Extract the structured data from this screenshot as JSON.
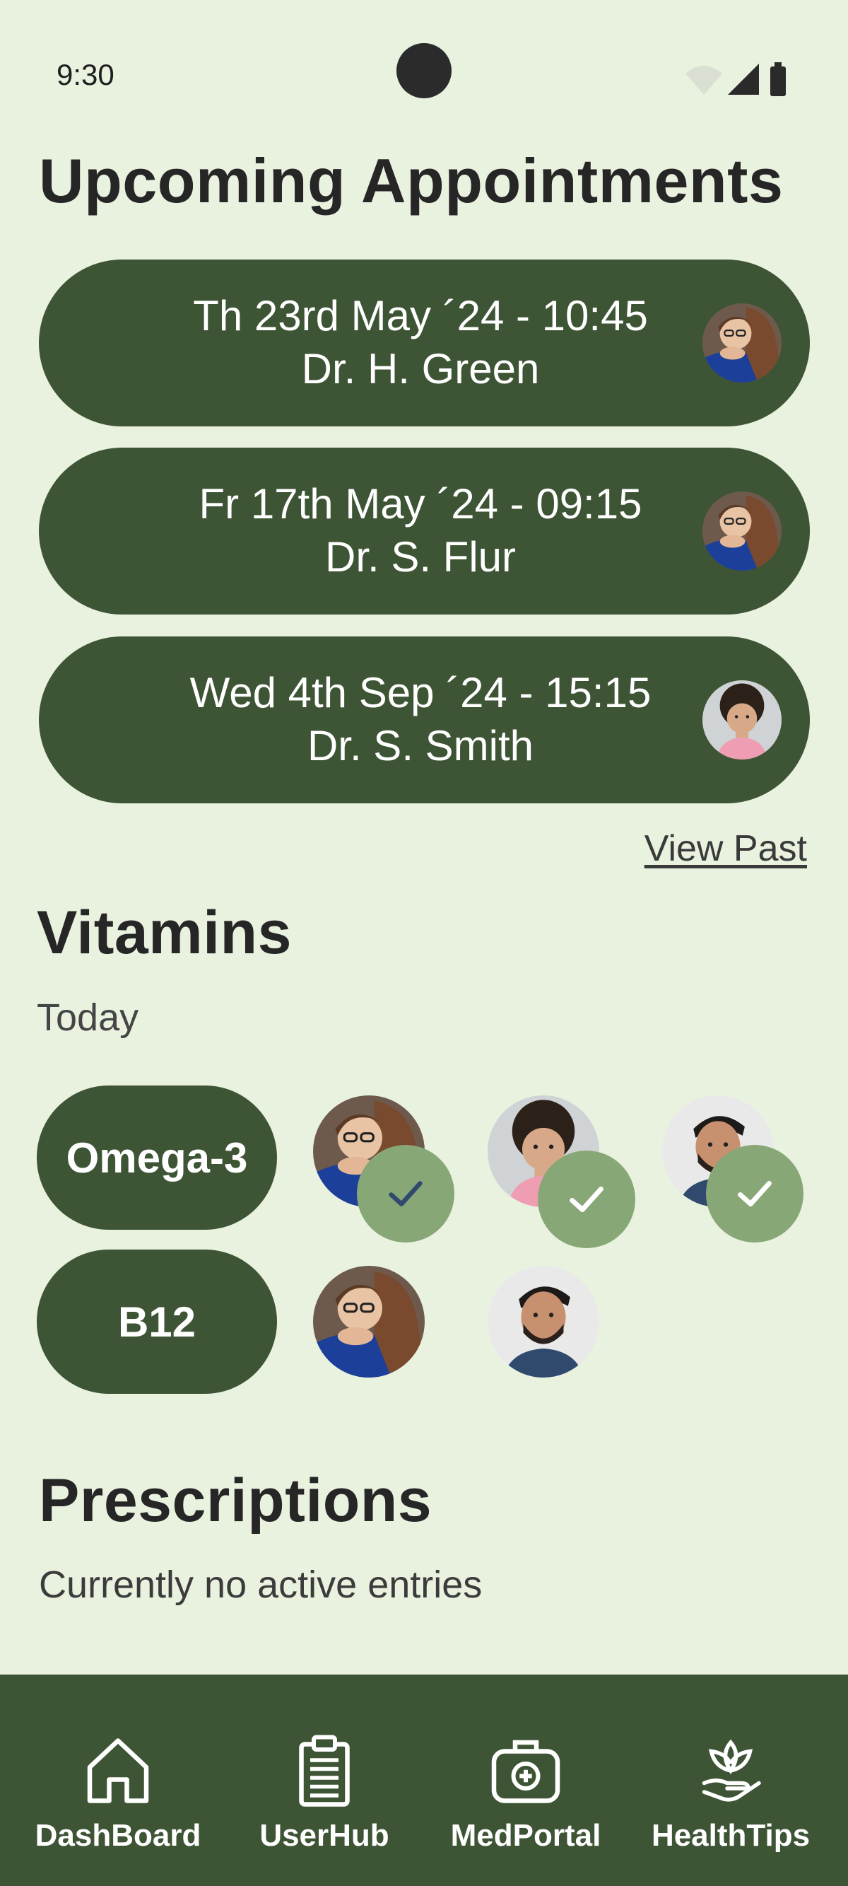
{
  "status": {
    "time": "9:30"
  },
  "appointments": {
    "title": "Upcoming Appointments",
    "items": [
      {
        "date": "Th 23rd May ´24 - 10:45",
        "doctor": "Dr. H. Green"
      },
      {
        "date": "Fr 17th May ´24 - 09:15",
        "doctor": "Dr. S. Flur"
      },
      {
        "date": "Wed 4th Sep ´24 - 15:15",
        "doctor": "Dr. S. Smith"
      }
    ],
    "view_past": "View Past"
  },
  "vitamins": {
    "title": "Vitamins",
    "subtitle": "Today",
    "items": [
      {
        "name": "Omega-3"
      },
      {
        "name": "B12"
      }
    ]
  },
  "prescriptions": {
    "title": "Prescriptions",
    "empty_text": "Currently no active entries"
  },
  "nav": [
    {
      "label": "DashBoard",
      "icon": "home-icon"
    },
    {
      "label": "UserHub",
      "icon": "clipboard-icon"
    },
    {
      "label": "MedPortal",
      "icon": "medkit-icon"
    },
    {
      "label": "HealthTips",
      "icon": "lotus-hand-icon"
    }
  ],
  "colors": {
    "background": "#e9f1df",
    "primary": "#3e5535",
    "check": "#88a777"
  }
}
